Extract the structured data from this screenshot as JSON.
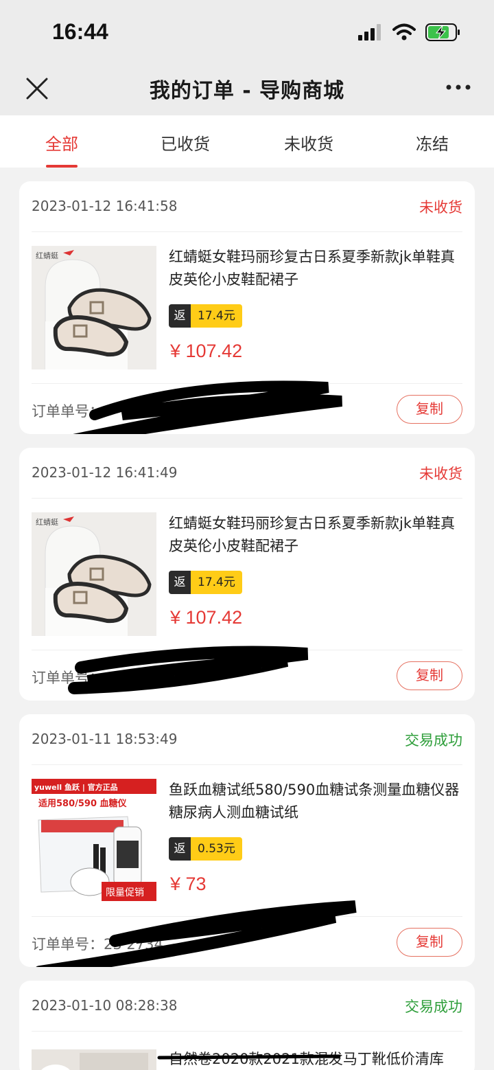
{
  "status_bar": {
    "time": "16:44"
  },
  "header": {
    "title": "我的订单 - 导购商城"
  },
  "tabs": [
    {
      "label": "全部"
    },
    {
      "label": "已收货"
    },
    {
      "label": "未收货"
    },
    {
      "label": "冻结"
    }
  ],
  "orders": [
    {
      "date": "2023-01-12 16:41:58",
      "status": "未收货",
      "product": "红蜻蜓女鞋玛丽珍复古日系夏季新款jk单鞋真皮英伦小皮鞋配裙子",
      "rebate_tag": "返",
      "rebate": "17.4元",
      "price": "¥ 107.42",
      "order_no": "订单单号：",
      "copy": "复制"
    },
    {
      "date": "2023-01-12 16:41:49",
      "status": "未收货",
      "product": "红蜻蜓女鞋玛丽珍复古日系夏季新款jk单鞋真皮英伦小皮鞋配裙子",
      "rebate_tag": "返",
      "rebate": "17.4元",
      "price": "¥ 107.42",
      "order_no": "订单单号：              77442734",
      "copy": "复制"
    },
    {
      "date": "2023-01-11 18:53:49",
      "status": "交易成功",
      "product": "鱼跃血糖试纸580/590血糖试条测量血糖仪器糖尿病人测血糖试纸",
      "rebate_tag": "返",
      "rebate": "0.53元",
      "price": "¥ 73",
      "order_no": "订单单号：23                  2734",
      "copy": "复制"
    },
    {
      "date": "2023-01-10 08:28:38",
      "status": "交易成功",
      "product": "自然卷2020款2021款混发马丁靴低价清库"
    }
  ],
  "thumb_text": {
    "shoe_brand": "红蜻蜓",
    "yuwell_brand": "yuwell 鱼跃 | 官方正品",
    "yuwell_model": "适用580/590  血糖仪",
    "yuwell_promo": "限量促销"
  },
  "colors": {
    "accent_red": "#e53935",
    "success_green": "#2e9e3a",
    "rebate_yellow": "#ffcc17"
  }
}
